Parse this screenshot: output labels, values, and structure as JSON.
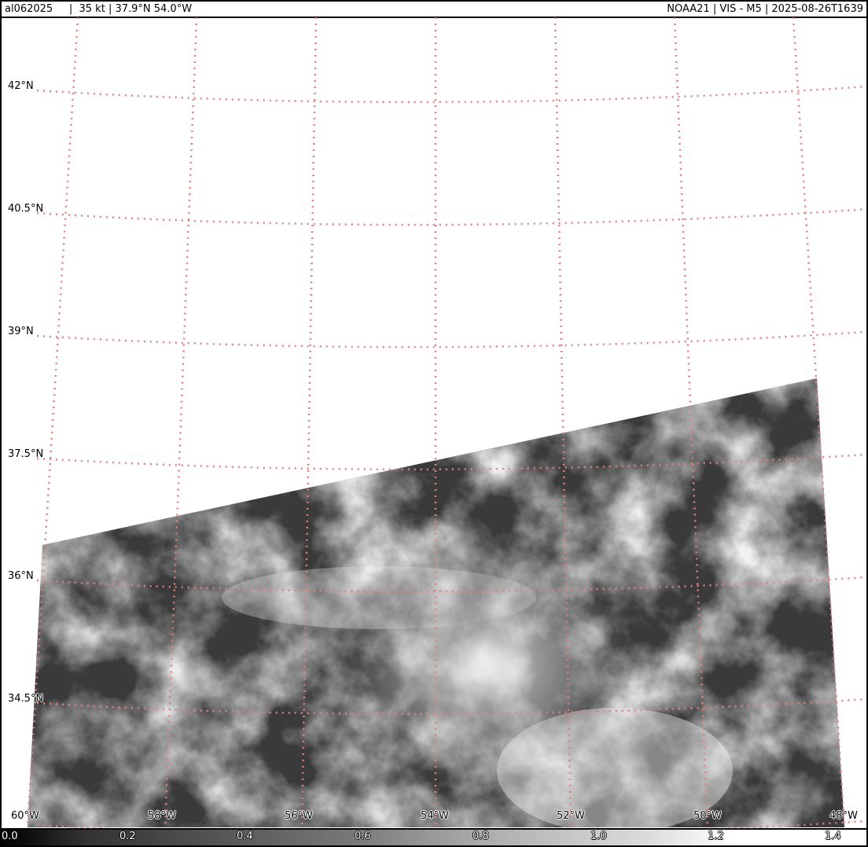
{
  "header": {
    "left": "al062025     |  35 kt | 37.9°N 54.0°W",
    "right": "NOAA21 | VIS - M5 | 2025-08-26T1639"
  },
  "map": {
    "lat_labels": [
      "42°N",
      "40.5°N",
      "39°N",
      "37.5°N",
      "36°N",
      "34.5°N"
    ],
    "lon_labels": [
      "60°W",
      "58°W",
      "56°W",
      "54°W",
      "52°W",
      "50°W",
      "48°W"
    ],
    "grid_color": "#e08080"
  },
  "colorbar": {
    "ticks": [
      "0.0",
      "0.2",
      "0.4",
      "0.6",
      "0.8",
      "1.0",
      "1.2",
      "1.4"
    ]
  }
}
